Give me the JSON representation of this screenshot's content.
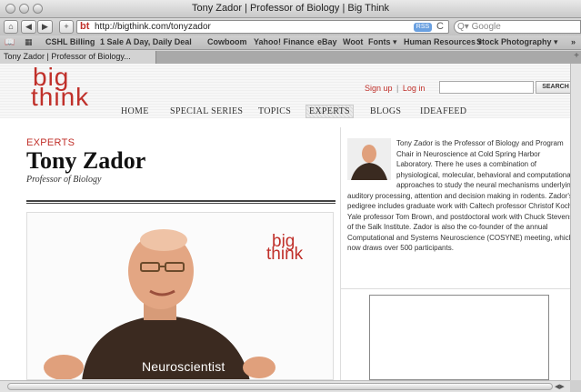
{
  "window": {
    "title": "Tony Zador | Professor of Biology | Big Think"
  },
  "toolbar": {
    "back": "◀",
    "forward": "▶",
    "add": "+",
    "favicon": "bt",
    "url": "http://bigthink.com/tonyzador",
    "rss": "RSS",
    "reload": "C",
    "search_placeholder": "Q▾ Google"
  },
  "bookmarks": {
    "items": [
      "CSHL Billing",
      "1 Sale A Day, Daily Deal",
      "Cowboom",
      "Yahoo! Finance",
      "eBay",
      "Woot",
      "Fonts ▾",
      "Human Resources ▾",
      "Stock Photography ▾"
    ],
    "overflow": "»"
  },
  "tabs": {
    "active": "Tony Zador | Professor of Biology...",
    "new": "+"
  },
  "site": {
    "logo_line1": "big",
    "logo_line2": "think",
    "signup": "Sign up",
    "separator": "|",
    "login": "Log in",
    "search_button": "SEARCH",
    "nav": [
      "HOME",
      "SPECIAL SERIES",
      "TOPICS",
      "EXPERTS",
      "BLOGS",
      "IDEAFEED"
    ],
    "active_nav": "EXPERTS",
    "accent_color": "#c0302a"
  },
  "profile": {
    "section": "EXPERTS",
    "name": "Tony Zador",
    "title": "Professor of Biology",
    "video_caption": "Neuroscientist",
    "video_logo_line1": "big",
    "video_logo_line2": "think",
    "bio": "Tony Zador is the Professor of Biology and Program Chair in Neuroscience at Cold Spring Harbor Laboratory. There he uses a combination of physiological, molecular, behavioral and computational approaches to study the neural mechanisms underlying auditory processing, attention and decision making in rodents. Zador's pedigree includes graduate work with Caltech professor Christof Koch, Yale professor Tom Brown, and postdoctoral work with Chuck Stevens of the Salk Institute. Zador is also the co-founder of the annual Computational and Systems Neuroscience (COSYNE) meeting, which now draws over 500 participants."
  }
}
